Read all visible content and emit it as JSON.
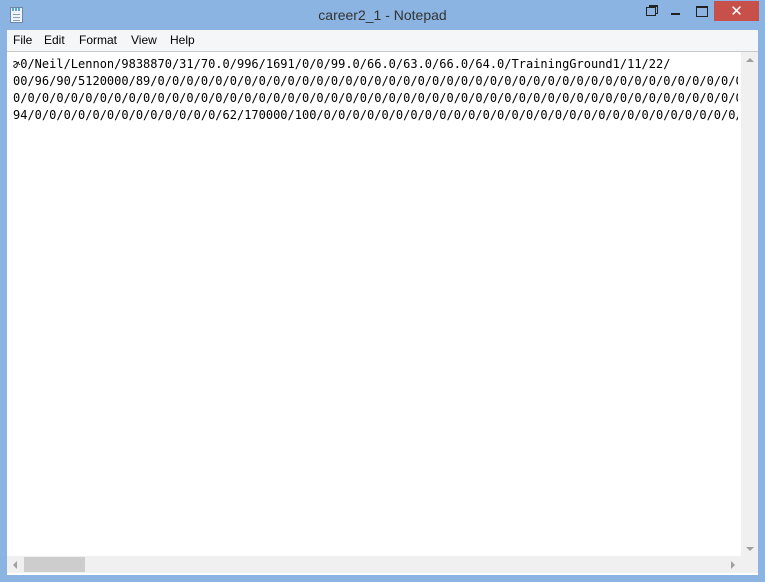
{
  "window": {
    "title": "career2_1 - Notepad",
    "icon": "notepad-icon",
    "controls": [
      "restore-icon",
      "minimize-icon",
      "maximize-icon",
      "close-icon"
    ],
    "close_glyph": "✕",
    "close_color": "#c7504b"
  },
  "menu": {
    "file": "File",
    "edit": "Edit",
    "format": "Format",
    "view": "View",
    "help": "Help"
  },
  "document": {
    "lines": [
      "ɚ0/Neil/Lennon/9838870/31/70.0/996/1691/0/0/99.0/66.0/63.0/66.0/64.0/TrainingGround1/11/22/",
      "00/96/90/5120000/89/0/0/0/0/0/0/0/0/0/0/0/0/0/0/0/0/0/0/0/0/0/0/0/0/0/0/0/0/0/0/0/0/0/0/0/0/0/0/0/0/0/0/0/0/0/0/0/0/0/",
      "0/0/0/0/0/0/0/0/0/0/0/0/0/0/0/0/0/0/0/0/0/0/0/0/0/0/0/0/0/0/0/0/0/0/0/0/0/0/0/0/0/0/0/0/0/0/0/0/0/0/0/0/0/0/0/0/",
      "94/0/0/0/0/0/0/0/0/0/0/0/0/0/62/170000/100/0/0/0/0/0/0/0/0/0/0/0/0/0/0/0/0/0/0/0/0/0/0/0/0/0/0/0/0/0/"
    ]
  }
}
